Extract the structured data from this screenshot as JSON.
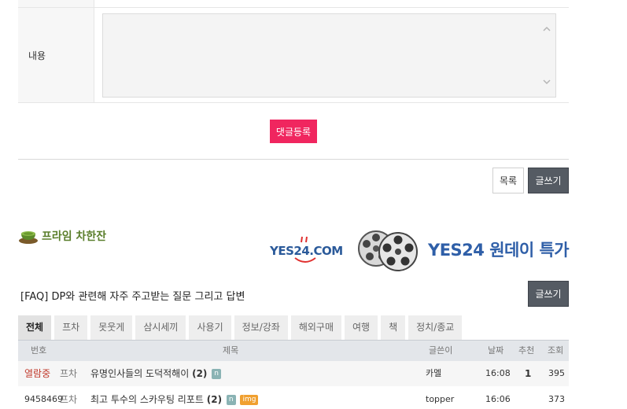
{
  "comment_form": {
    "content_label": "내용",
    "submit_label": "댓글등록"
  },
  "actions": {
    "list_label": "목록",
    "write_label": "글쓰기"
  },
  "board": {
    "title": "프라임 차한잔"
  },
  "banner": {
    "yes24_logo": "YES24.COM",
    "oneday": "YES24 원데이 특가"
  },
  "faq": {
    "title": "[FAQ] DP와 관련해 자주 주고받는 질문 그리고 답변",
    "write_label": "글쓰기"
  },
  "tabs": [
    "전체",
    "프차",
    "못웃게",
    "삼시세끼",
    "사용기",
    "정보/강좌",
    "해외구매",
    "여행",
    "책",
    "정치/종교"
  ],
  "table": {
    "headers": {
      "num": "번호",
      "title": "제목",
      "author": "글쓴이",
      "date": "날짜",
      "rec": "추천",
      "views": "조회"
    },
    "rows": [
      {
        "num": "열람중",
        "cat": "프차",
        "title": "유명인사들의 도덕적해이",
        "count": "(2)",
        "badges": [
          "n"
        ],
        "author": "카멜",
        "time": "16:08",
        "rec": "1",
        "views": "395"
      },
      {
        "num": "9458469",
        "cat": "프차",
        "title": "최고 투수의 스카우팅 리포트",
        "count": "(2)",
        "badges": [
          "n",
          "img"
        ],
        "author": "topper",
        "time": "16:06",
        "rec": "",
        "views": "373"
      }
    ]
  },
  "colors": {
    "submit": "#f0265f",
    "dark_button": "#555b63",
    "board_title": "#5a7e2b",
    "banner_blue": "#2f5fa8",
    "hot": "#c0392b"
  }
}
